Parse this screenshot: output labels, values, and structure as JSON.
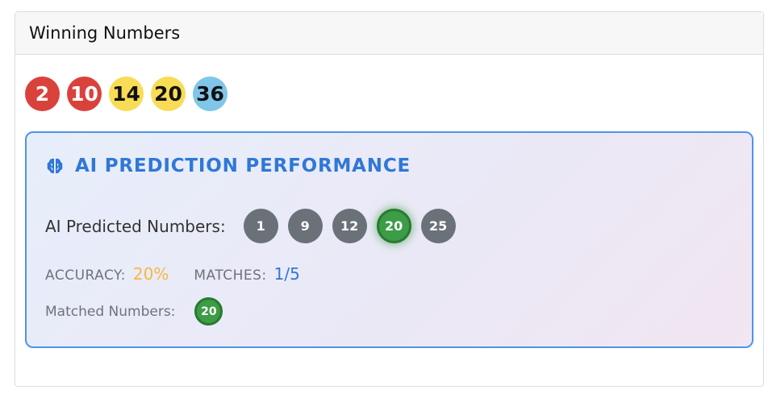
{
  "card": {
    "title": "Winning Numbers"
  },
  "winning_numbers": [
    {
      "value": "2",
      "color": "#d9423b"
    },
    {
      "value": "10",
      "color": "#d9423b"
    },
    {
      "value": "14",
      "color": "#f8dc56"
    },
    {
      "value": "20",
      "color": "#f8dc56"
    },
    {
      "value": "36",
      "color": "#7fc6e8"
    }
  ],
  "ai": {
    "icon": "brain-icon",
    "title": "AI PREDICTION PERFORMANCE",
    "predicted_label": "AI Predicted Numbers:",
    "predicted": [
      "1",
      "9",
      "12",
      "20",
      "25"
    ],
    "accuracy_label": "ACCURACY:",
    "accuracy_value": "20%",
    "matches_label": "MATCHES:",
    "matches_value": "1/5",
    "matched_label": "Matched Numbers:",
    "matched": [
      "20"
    ]
  },
  "colors": {
    "accent_blue": "#2f78d6",
    "match_green": "#3d9c46",
    "neutral_ball": "#6a7178",
    "accuracy_orange": "#f6b73e"
  }
}
